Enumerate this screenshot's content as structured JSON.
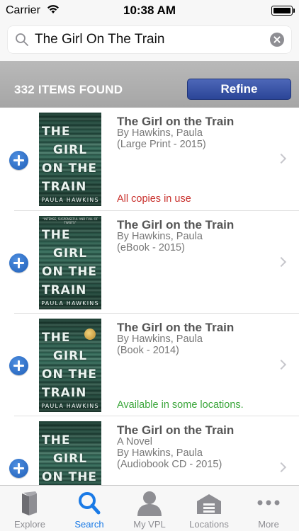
{
  "status_bar": {
    "carrier": "Carrier",
    "time": "10:38 AM"
  },
  "search": {
    "value": "The Girl On The Train"
  },
  "results": {
    "count_label": "332 ITEMS FOUND",
    "refine_label": "Refine"
  },
  "items": [
    {
      "title": "The Girl on the Train",
      "lines": [
        "By Hawkins, Paula",
        "(Large Print - 2015)"
      ],
      "status": "All copies in use",
      "status_color": "#c9302c",
      "cover": {
        "title_lines": [
          "THE",
          "GIRL",
          "ON THE",
          "TRAIN"
        ],
        "author": "PAULA HAWKINS"
      }
    },
    {
      "title": "The Girl on the Train",
      "lines": [
        "By Hawkins, Paula",
        "(eBook - 2015)"
      ],
      "status": "",
      "cover": {
        "title_lines": [
          "THE",
          "GIRL",
          "ON THE",
          "TRAIN"
        ],
        "author": "PAULA HAWKINS"
      }
    },
    {
      "title": "The Girl on the Train",
      "lines": [
        "By Hawkins, Paula",
        "(Book - 2014)"
      ],
      "status": "Available in some locations.",
      "status_color": "#3aa63a",
      "cover": {
        "title_lines": [
          "THE",
          "GIRL",
          "ON THE",
          "TRAIN"
        ],
        "author": "PAULA HAWKINS"
      }
    },
    {
      "title": "The Girl on the Train",
      "lines": [
        "A Novel",
        "By Hawkins, Paula",
        "(Audiobook CD - 2015)"
      ],
      "status": "",
      "cover": {
        "title_lines": [
          "THE",
          "GIRL",
          "ON THE"
        ],
        "author": ""
      }
    }
  ],
  "tabs": [
    {
      "label": "Explore",
      "icon": "book-icon",
      "active": false
    },
    {
      "label": "Search",
      "icon": "search-icon",
      "active": true
    },
    {
      "label": "My VPL",
      "icon": "person-icon",
      "active": false
    },
    {
      "label": "Locations",
      "icon": "library-building-icon",
      "active": false
    },
    {
      "label": "More",
      "icon": "more-dots-icon",
      "active": false
    }
  ],
  "colors": {
    "accent": "#1a7ae6",
    "refine_button": "#2b4597",
    "status_unavailable": "#c9302c",
    "status_available": "#3aa63a"
  }
}
